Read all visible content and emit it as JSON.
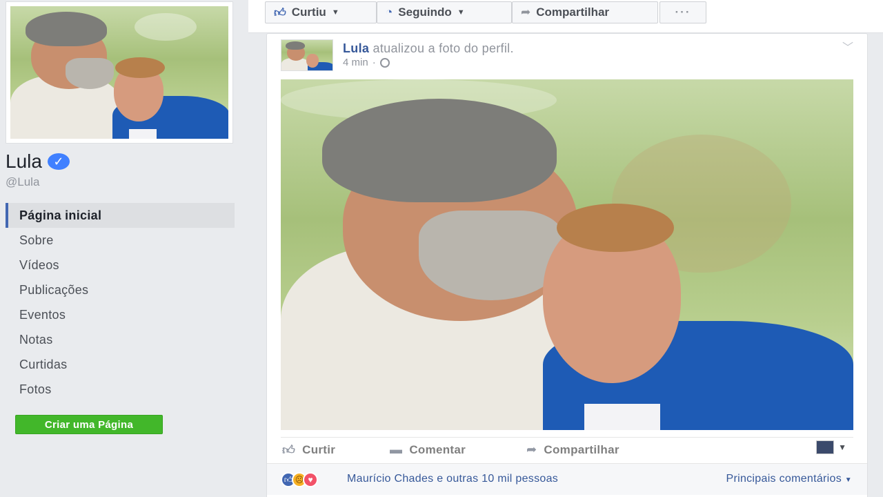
{
  "page": {
    "name": "Lula",
    "handle": "@Lula",
    "verified_icon": "check-icon"
  },
  "nav": {
    "items": [
      {
        "label": "Página inicial"
      },
      {
        "label": "Sobre"
      },
      {
        "label": "Vídeos"
      },
      {
        "label": "Publicações"
      },
      {
        "label": "Eventos"
      },
      {
        "label": "Notas"
      },
      {
        "label": "Curtidas"
      },
      {
        "label": "Fotos"
      }
    ],
    "active_index": 0,
    "create_page_label": "Criar uma Página"
  },
  "actions": {
    "like_label": "Curtiu",
    "follow_label": "Seguindo",
    "share_label": "Compartilhar",
    "more_label": "···"
  },
  "post": {
    "author": "Lula",
    "action_text": "atualizou a foto do perfil.",
    "time": "4 min",
    "separator": "·",
    "like_label": "Curtir",
    "comment_label": "Comentar",
    "share_label": "Compartilhar",
    "reactions_text": "Maurício Chades e outras 10 mil pessoas",
    "sort_label": "Principais comentários"
  },
  "colors": {
    "brand_blue": "#4267b2",
    "link_blue": "#365899",
    "create_green": "#42b72a",
    "background": "#e9ebee"
  }
}
